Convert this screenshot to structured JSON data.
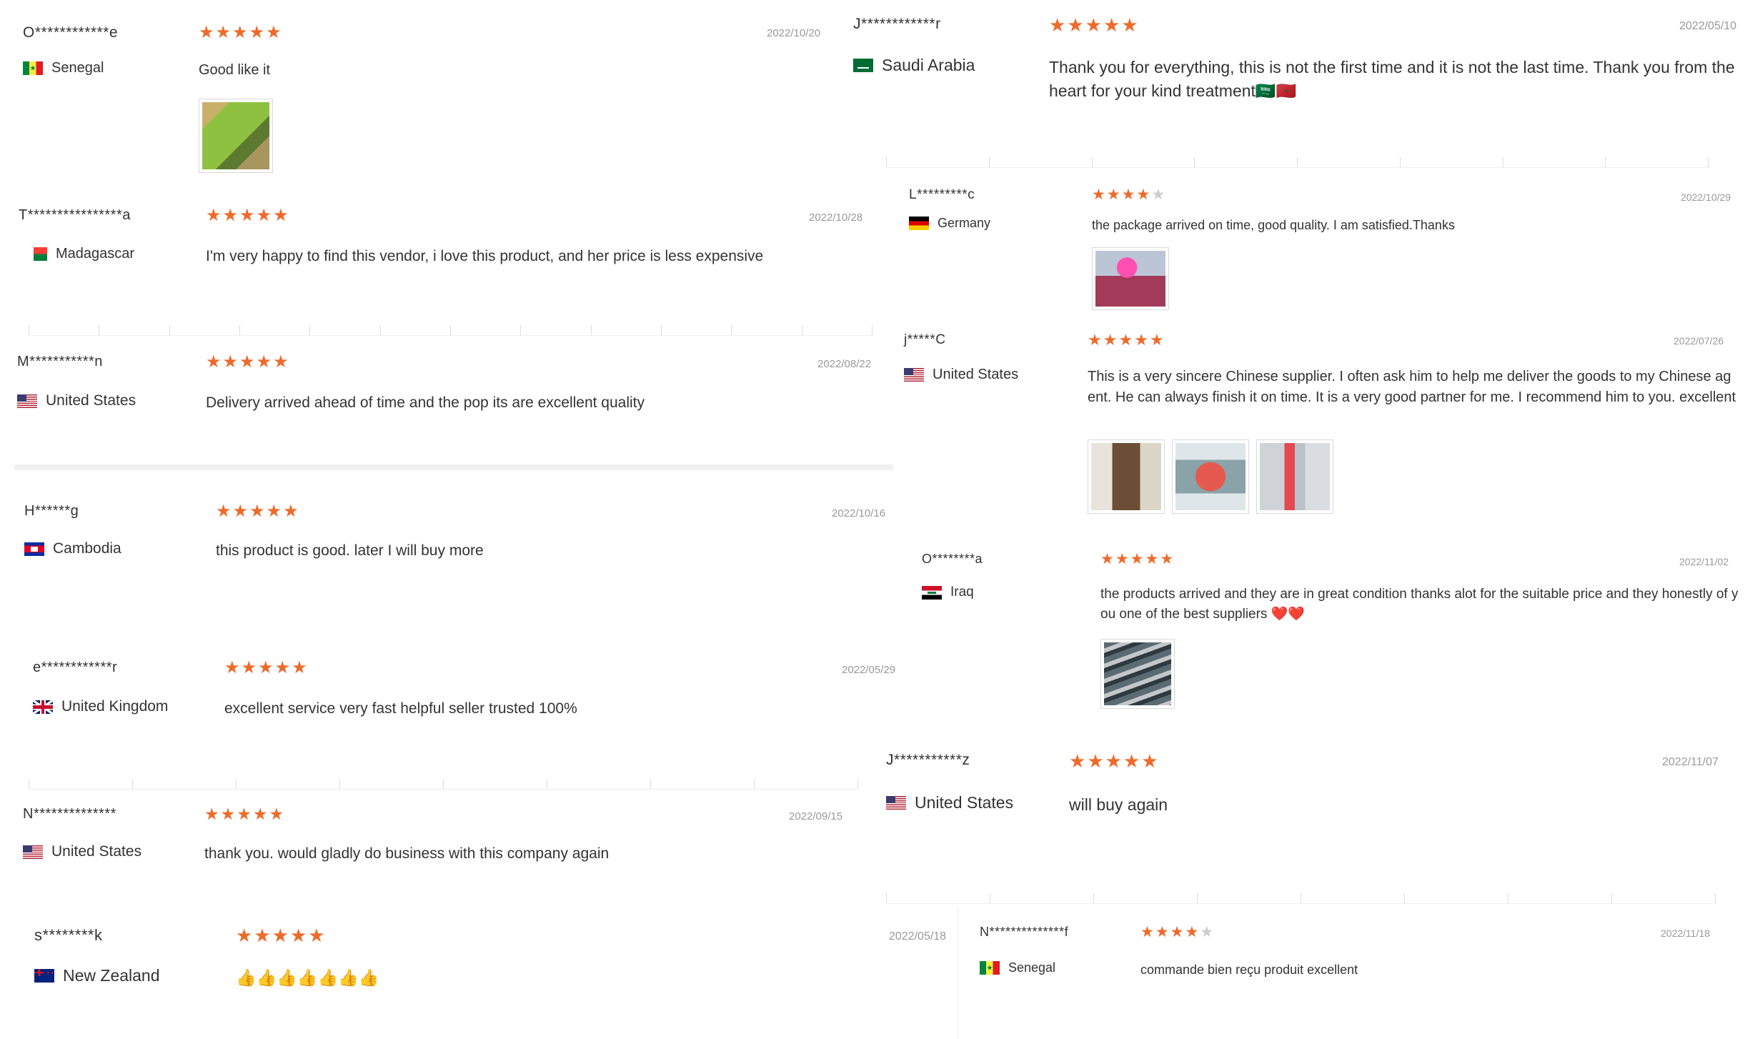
{
  "reviews": [
    {
      "id": "r1",
      "name": "O************e",
      "country": "Senegal",
      "flag": "senegal-flag-icon",
      "stars": 5,
      "date": "2022/10/20",
      "text": "Good like it",
      "photos": [
        "img-box"
      ]
    },
    {
      "id": "r2",
      "name": "J************r",
      "country": "Saudi Arabia",
      "flag": "saudi-arabia-flag-icon",
      "stars": 5,
      "date": "2022/05/10",
      "text": "Thank you for everything, this is not the first time and it is not the last time. Thank you from the heart for your kind treatment🇸🇦🇲🇦",
      "photos": []
    },
    {
      "id": "r3",
      "name": "T****************a",
      "country": "Madagascar",
      "flag": "madagascar-flag-icon",
      "stars": 5,
      "date": "2022/10/28",
      "text": "I'm very happy to find this vendor, i love this product, and her price is less expensive",
      "photos": []
    },
    {
      "id": "r4",
      "name": "L*********c",
      "country": "Germany",
      "flag": "germany-flag-icon",
      "stars": 4,
      "date": "2022/10/29",
      "text": "the package arrived on time, good quality. I am satisfied.Thanks",
      "photos": [
        "img-pink"
      ]
    },
    {
      "id": "r5",
      "name": "M***********n",
      "country": "United States",
      "flag": "united-states-flag-icon",
      "stars": 5,
      "date": "2022/08/22",
      "text": "Delivery arrived ahead of time and the pop its are excellent quality",
      "photos": []
    },
    {
      "id": "r6",
      "name": "j*****C",
      "country": "United States",
      "flag": "united-states-flag-icon",
      "stars": 5,
      "date": "2022/07/26",
      "text": "This is a very sincere Chinese supplier. I often ask him to help me deliver the goods to my Chinese agent. He can always finish it on time. It is a very good partner for me. I recommend him to you. excellent",
      "photos": [
        "img-cart1",
        "img-cake",
        "img-stand"
      ]
    },
    {
      "id": "r7",
      "name": "H******g",
      "country": "Cambodia",
      "flag": "cambodia-flag-icon",
      "stars": 5,
      "date": "2022/10/16",
      "text": "this product is good. later I will buy more",
      "photos": []
    },
    {
      "id": "r8",
      "name": "O********a",
      "country": "Iraq",
      "flag": "iraq-flag-icon",
      "stars": 5,
      "date": "2022/11/02",
      "text": "the products arrived and they are in great condition thanks alot for the suitable price and they honestly of you one of the best suppliers ❤️❤️",
      "photos": [
        "img-bags"
      ]
    },
    {
      "id": "r9",
      "name": "e************r",
      "country": "United Kingdom",
      "flag": "united-kingdom-flag-icon",
      "stars": 5,
      "date": "2022/05/29",
      "text": "excellent service very fast helpful seller trusted 100%",
      "photos": []
    },
    {
      "id": "r10",
      "name": "J***********z",
      "country": "United States",
      "flag": "united-states-flag-icon",
      "stars": 5,
      "date": "2022/11/07",
      "text": "will buy again",
      "photos": []
    },
    {
      "id": "r11",
      "name": "N**************",
      "country": "United States",
      "flag": "united-states-flag-icon",
      "stars": 5,
      "date": "2022/09/15",
      "text": "thank you. would gladly do business with this company again",
      "photos": []
    },
    {
      "id": "r12",
      "name": "s********k",
      "country": "New Zealand",
      "flag": "new-zealand-flag-icon",
      "stars": 5,
      "date": "2022/05/18",
      "text": "👍👍👍👍👍👍👍",
      "photos": []
    },
    {
      "id": "r13",
      "name": "N**************f",
      "country": "Senegal",
      "flag": "senegal-flag-icon",
      "stars": 4,
      "date": "2022/11/18",
      "text": "commande bien reçu produit excellent",
      "photos": []
    }
  ],
  "colors": {
    "star_filled": "#ee6a2b",
    "star_empty": "#cccccc",
    "date": "#999999",
    "text": "#333333"
  }
}
